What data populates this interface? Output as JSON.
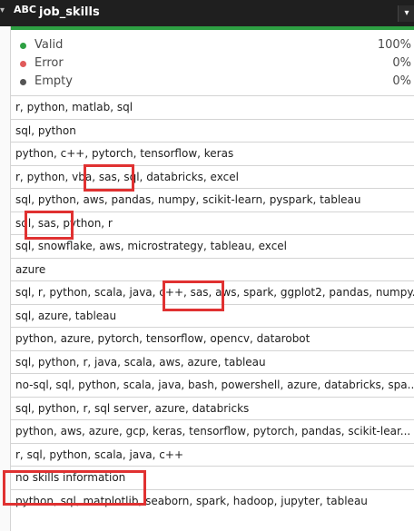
{
  "column": {
    "type_icon": "ABC",
    "title": "job_skills"
  },
  "profile": {
    "valid_label": "Valid",
    "valid_pct": "100%",
    "valid_color": "#2ea043",
    "error_label": "Error",
    "error_pct": "0%",
    "error_color": "#e05a5a",
    "empty_label": "Empty",
    "empty_pct": "0%",
    "empty_color": "#555555"
  },
  "rows": [
    "r, python, matlab, sql",
    "sql, python",
    "python, c++, pytorch, tensorflow, keras",
    "r, python, vba, sas, sql, databricks, excel",
    "sql, python, aws, pandas, numpy, scikit-learn, pyspark, tableau",
    "sql, sas, python, r",
    "sql, snowflake, aws, microstrategy, tableau, excel",
    "azure",
    "sql, r, python, scala, java, c++, sas, aws, spark, ggplot2, pandas, numpy...",
    "sql, azure, tableau",
    "python, azure, pytorch, tensorflow, opencv, datarobot",
    "sql, python, r, java, scala, aws, azure, tableau",
    "no-sql, sql, python, scala, java, bash, powershell, azure, databricks, spa...",
    "sql, python, r, sql server, azure, databricks",
    "python, aws, azure, gcp, keras, tensorflow, pytorch, pandas, scikit-lear...",
    "r, sql, python, scala, java, c++",
    "no skills information",
    "python, sql, matplotlib, seaborn, spark, hadoop, jupyter, tableau"
  ],
  "accent_color": "#e03131"
}
